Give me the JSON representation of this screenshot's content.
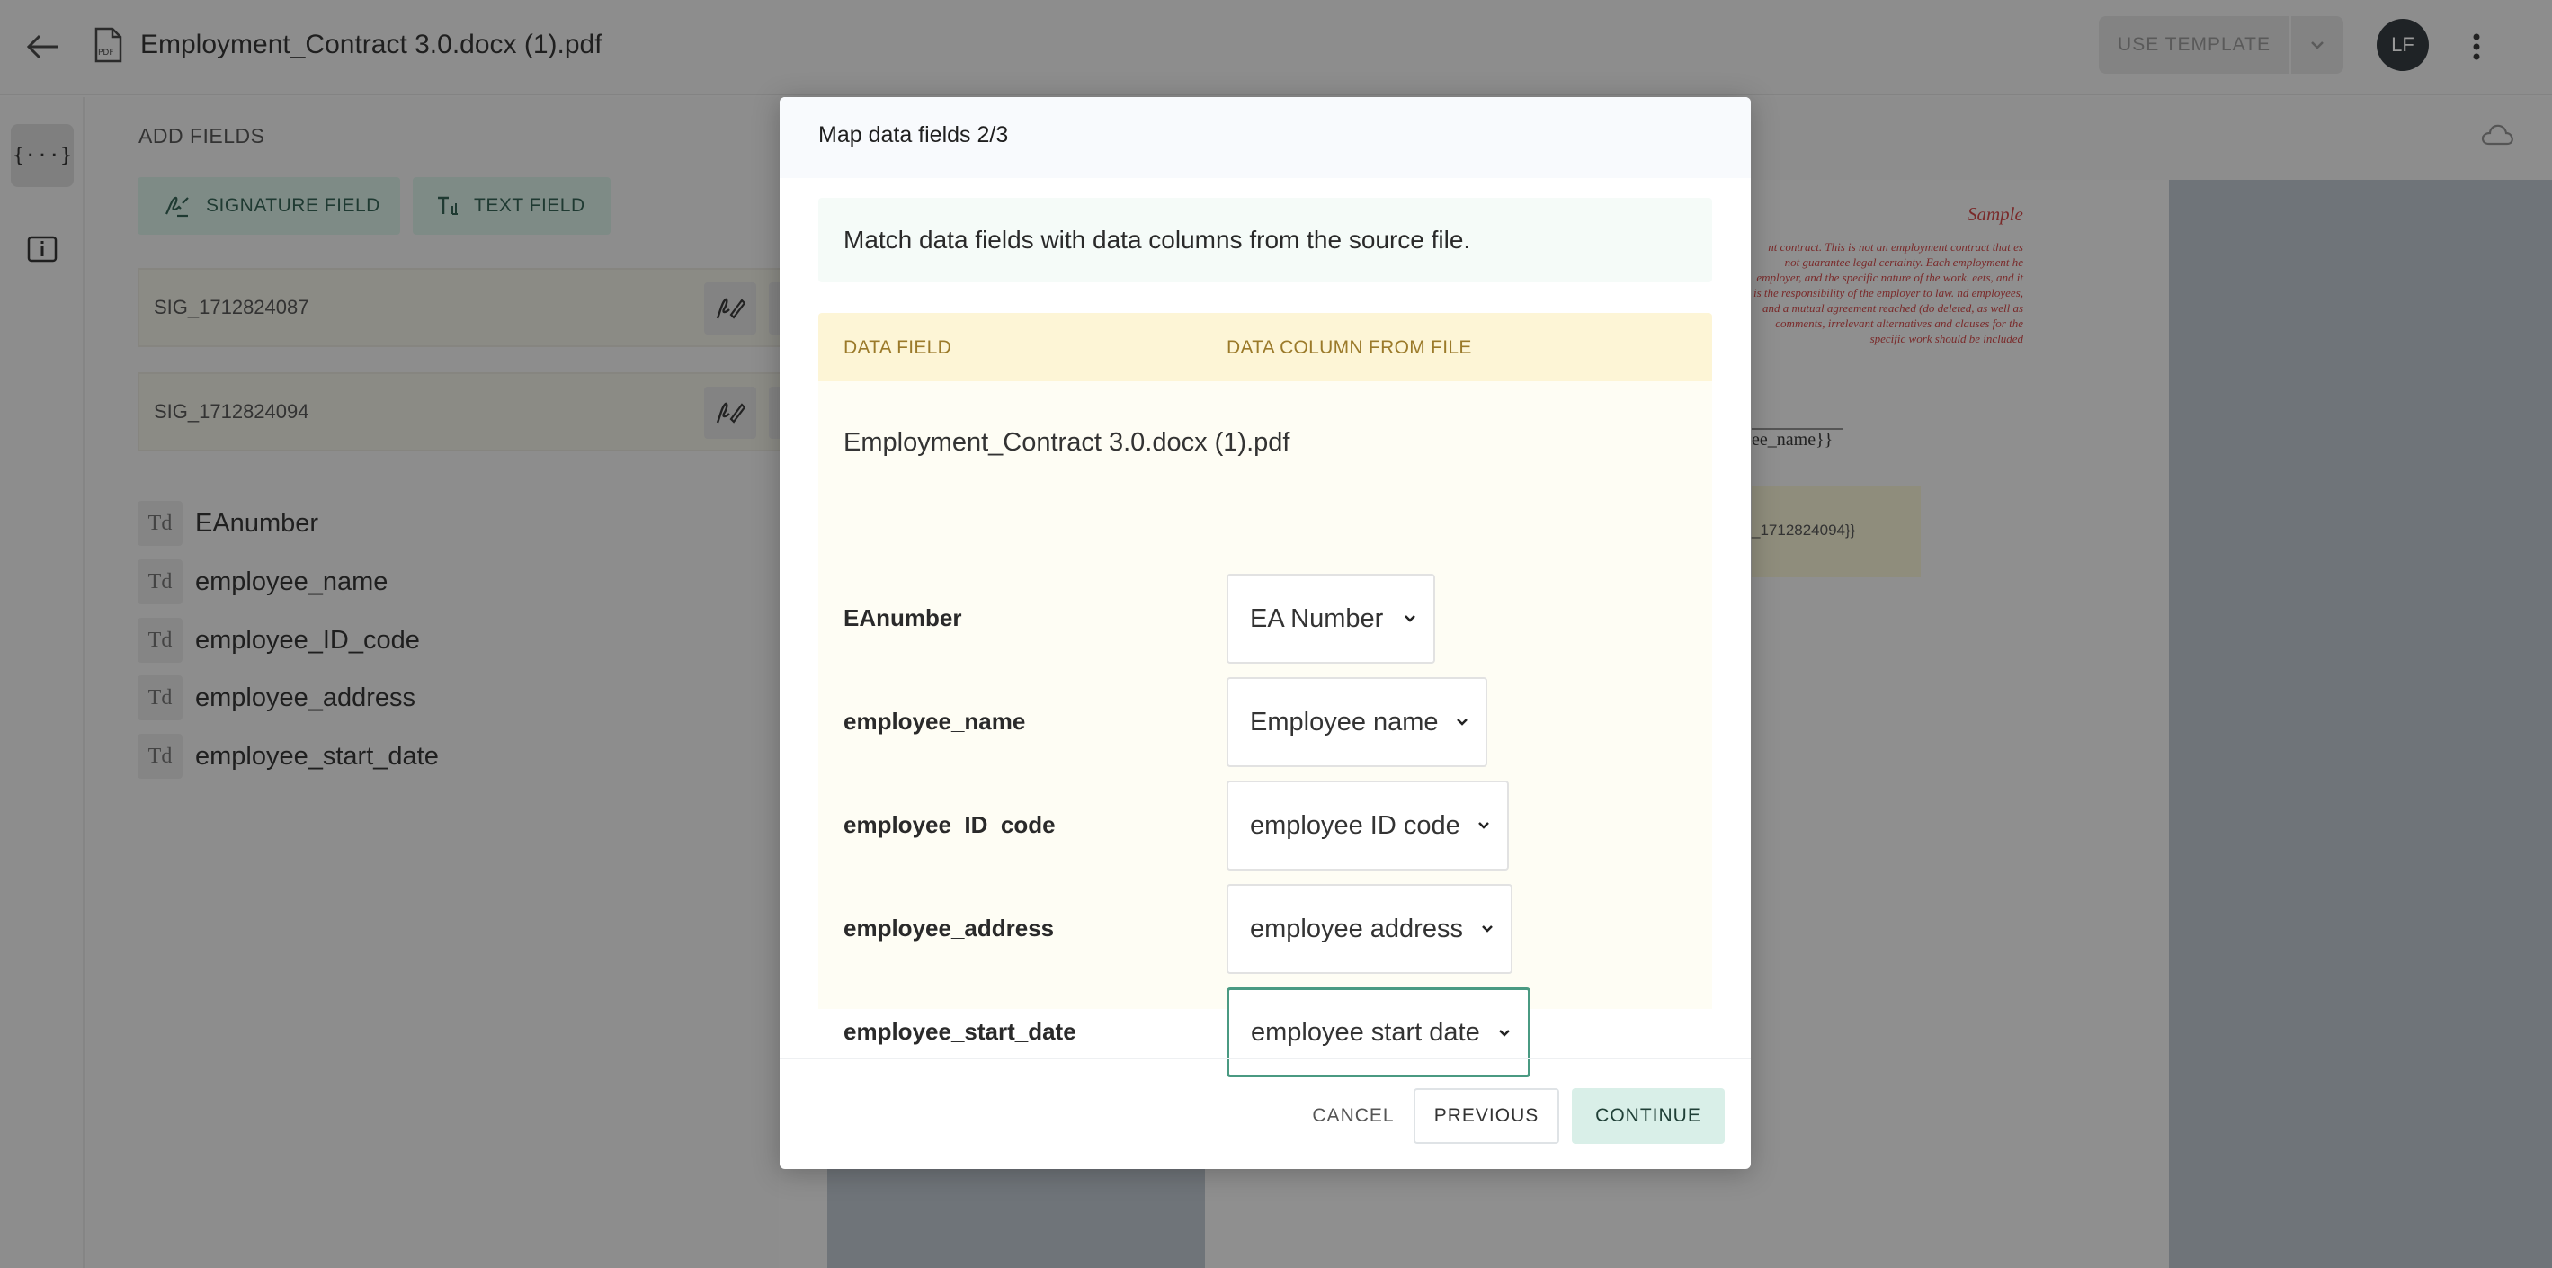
{
  "header": {
    "document_title": "Employment_Contract 3.0.docx (1).pdf",
    "use_template_label": "USE TEMPLATE",
    "avatar_initials": "LF"
  },
  "left_panel": {
    "section_title": "ADD FIELDS",
    "signature_button_label": "SIGNATURE FIELD",
    "text_button_label": "TEXT FIELD",
    "signature_fields": [
      {
        "name": "SIG_1712824087"
      },
      {
        "name": "SIG_1712824094"
      }
    ],
    "text_fields": [
      {
        "name": "EAnumber"
      },
      {
        "name": "employee_name"
      },
      {
        "name": "employee_ID_code"
      },
      {
        "name": "employee_address"
      },
      {
        "name": "employee_start_date"
      }
    ]
  },
  "document_preview": {
    "sample_label": "Sample",
    "red_text": "nt contract. This is not an employment contract that es not guarantee legal certainty. Each employment he employer, and the specific nature of the work. eets, and it is the responsibility of the employer to law. nd employees, and a mutual agreement reached (do deleted, as well as comments, irrelevant alternatives and clauses for the specific work should be included",
    "name_fragment": "ee_name}}",
    "signature_fragment": "_1712824094}}"
  },
  "modal": {
    "title": "Map data fields 2/3",
    "info": "Match data fields with data columns from the source file.",
    "column_data_field": "DATA FIELD",
    "column_data_column": "DATA COLUMN FROM FILE",
    "file_name": "Employment_Contract 3.0.docx (1).pdf",
    "mappings": [
      {
        "field": "EAnumber",
        "column": "EA Number"
      },
      {
        "field": "employee_name",
        "column": "Employee name"
      },
      {
        "field": "employee_ID_code",
        "column": "employee ID code"
      },
      {
        "field": "employee_address",
        "column": "employee address"
      },
      {
        "field": "employee_start_date",
        "column": "employee start date"
      }
    ],
    "cancel_label": "CANCEL",
    "previous_label": "PREVIOUS",
    "continue_label": "CONTINUE"
  },
  "colors": {
    "accent": "#4a9a82",
    "continue_bg": "#d9efe8",
    "table_header_bg": "#fdf5d6",
    "table_header_text": "#9b7a2a"
  }
}
